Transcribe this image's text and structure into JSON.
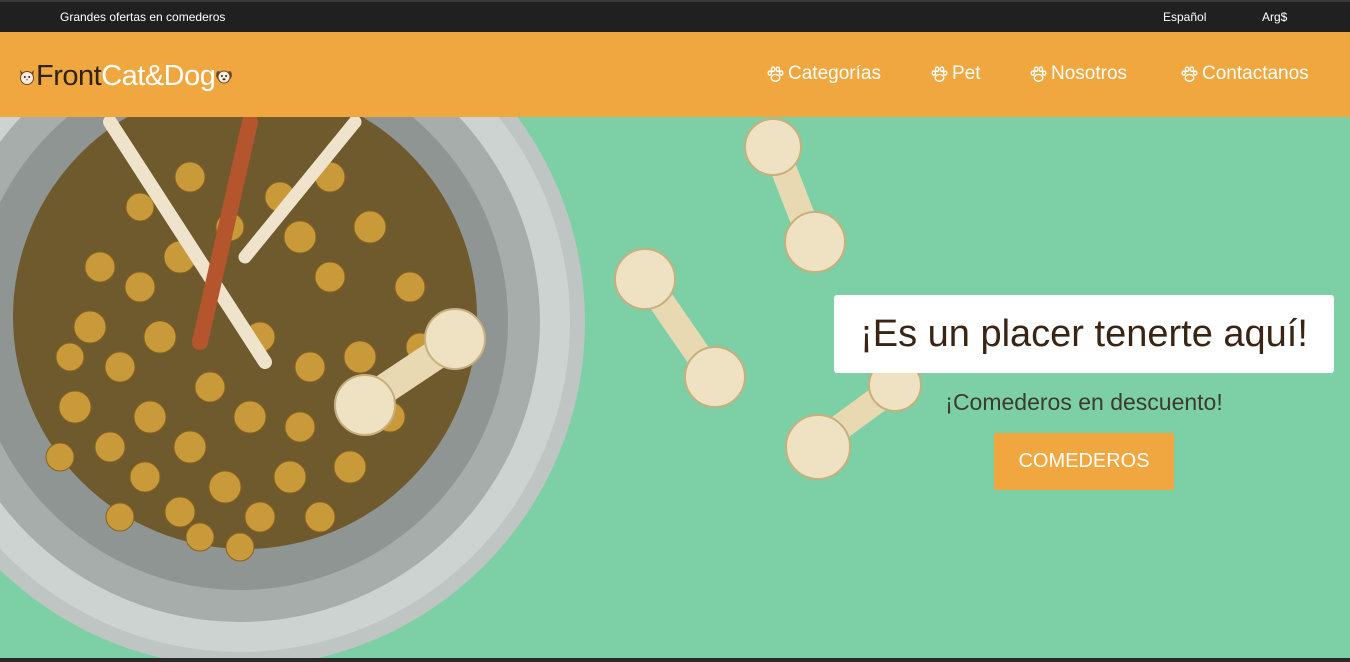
{
  "topbar": {
    "promo": "Grandes ofertas en comederos",
    "language": "Español",
    "currency": "Arg$"
  },
  "brand": {
    "part1": "Front",
    "part2": "Cat&Dog"
  },
  "nav": {
    "items": [
      {
        "label": "Categorías",
        "icon": "paw-icon"
      },
      {
        "label": "Pet",
        "icon": "paw-icon"
      },
      {
        "label": "Nosotros",
        "icon": "paw-icon"
      },
      {
        "label": "Contactanos",
        "icon": "paw-icon"
      }
    ]
  },
  "hero": {
    "title": "¡Es un placer tenerte aquí!",
    "subtitle": "¡Comederos en descuento!",
    "button": "COMEDEROS",
    "image": "pet-food-bowl-with-rawhide-bones"
  },
  "colors": {
    "accent": "#f0a73f",
    "topbar": "#202020",
    "hero_bg": "#7dcfa5",
    "title_text": "#3a2414"
  }
}
